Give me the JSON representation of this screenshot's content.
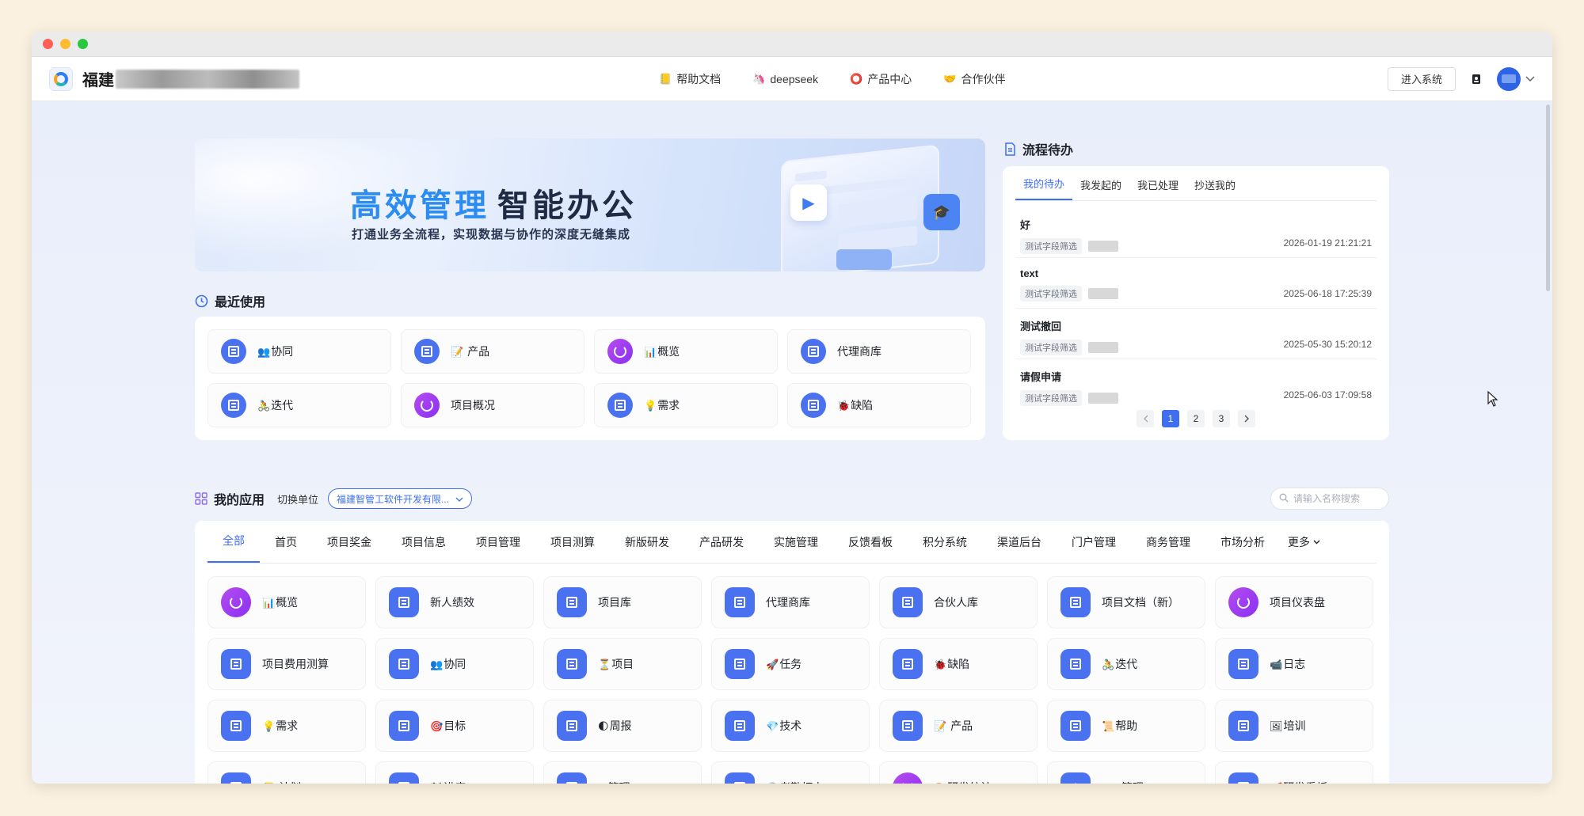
{
  "navbar": {
    "brand": "福建",
    "nav": [
      {
        "label": "帮助文档",
        "icon": "📒"
      },
      {
        "label": "deepseek",
        "icon": "🦄"
      },
      {
        "label": "产品中心",
        "icon": "⭕"
      },
      {
        "label": "合作伙伴",
        "icon": "🤝"
      }
    ],
    "enter": "进入系统"
  },
  "banner": {
    "title_blue": "高效管理",
    "title_dark": "智能办公",
    "subtitle": "打通业务全流程，实现数据与协作的深度无缝集成"
  },
  "recent": {
    "title": "最近使用",
    "items": [
      {
        "emoji": "👥",
        "label": "协同",
        "icon": "doc"
      },
      {
        "emoji": "📝",
        "label": " 产品",
        "icon": "doc"
      },
      {
        "emoji": "📊",
        "label": "概览",
        "icon": "pie"
      },
      {
        "emoji": "",
        "label": "代理商库",
        "icon": "doc"
      },
      {
        "emoji": "🚴",
        "label": "迭代",
        "icon": "doc"
      },
      {
        "emoji": "",
        "label": "项目概况",
        "icon": "pie"
      },
      {
        "emoji": "💡",
        "label": "需求",
        "icon": "doc"
      },
      {
        "emoji": "🐞",
        "label": "缺陷",
        "icon": "doc"
      }
    ]
  },
  "todo": {
    "title": "流程待办",
    "tabs": [
      "我的待办",
      "我发起的",
      "我已处理",
      "抄送我的"
    ],
    "items": [
      {
        "name": "好",
        "tag": "测试字段筛选",
        "time": "2026-01-19 21:21:21"
      },
      {
        "name": "text",
        "tag": "测试字段筛选",
        "time": "2025-06-18 17:25:39"
      },
      {
        "name": "测试撤回",
        "tag": "测试字段筛选",
        "time": "2025-05-30 15:20:12"
      },
      {
        "name": "请假申请",
        "tag": "测试字段筛选",
        "time": "2025-06-03 17:09:58"
      }
    ],
    "pages": [
      "1",
      "2",
      "3"
    ]
  },
  "apps": {
    "title": "我的应用",
    "switch_label": "切换单位",
    "unit": "福建智管工软件开发有限...",
    "search_placeholder": "请输入名称搜索",
    "categories": [
      "全部",
      "首页",
      "项目奖金",
      "项目信息",
      "项目管理",
      "项目测算",
      "新版研发",
      "产品研发",
      "实施管理",
      "反馈看板",
      "积分系统",
      "渠道后台",
      "门户管理",
      "商务管理",
      "市场分析"
    ],
    "more": "更多",
    "items": [
      {
        "emoji": "📊",
        "label": "概览",
        "icon": "pie"
      },
      {
        "emoji": "",
        "label": "新人绩效",
        "icon": "doc"
      },
      {
        "emoji": "",
        "label": "项目库",
        "icon": "doc"
      },
      {
        "emoji": "",
        "label": "代理商库",
        "icon": "doc"
      },
      {
        "emoji": "",
        "label": "合伙人库",
        "icon": "doc"
      },
      {
        "emoji": "",
        "label": "项目文档（新）",
        "icon": "doc"
      },
      {
        "emoji": "",
        "label": "项目仪表盘",
        "icon": "pie"
      },
      {
        "emoji": "",
        "label": "项目费用测算",
        "icon": "doc"
      },
      {
        "emoji": "👥",
        "label": "协同",
        "icon": "doc"
      },
      {
        "emoji": "⏳",
        "label": "项目",
        "icon": "doc"
      },
      {
        "emoji": "🚀",
        "label": "任务",
        "icon": "doc"
      },
      {
        "emoji": "🐞",
        "label": "缺陷",
        "icon": "doc"
      },
      {
        "emoji": "🚴",
        "label": "迭代",
        "icon": "doc"
      },
      {
        "emoji": "📹",
        "label": "日志",
        "icon": "doc"
      },
      {
        "emoji": "💡",
        "label": "需求",
        "icon": "doc"
      },
      {
        "emoji": "🎯",
        "label": "目标",
        "icon": "doc"
      },
      {
        "emoji": "🌓",
        "label": "周报",
        "icon": "doc"
      },
      {
        "emoji": "💎",
        "label": "技术",
        "icon": "doc"
      },
      {
        "emoji": "📝",
        "label": " 产品",
        "icon": "doc"
      },
      {
        "emoji": "📜",
        "label": "帮助",
        "icon": "doc"
      },
      {
        "emoji": "🖼",
        "label": "培训",
        "icon": "doc"
      },
      {
        "emoji": "📒",
        "label": " 计划",
        "icon": "doc"
      },
      {
        "emoji": "🏁",
        "label": "进度",
        "icon": "doc"
      },
      {
        "emoji": "⚙",
        "label": "管理",
        "icon": "doc"
      },
      {
        "emoji": "🕘",
        "label": "考勤打卡",
        "icon": "doc"
      },
      {
        "emoji": "🎨",
        "label": "研发统计",
        "icon": "pie"
      },
      {
        "emoji": "",
        "label": "Bug管理",
        "icon": "bug"
      },
      {
        "emoji": "🚀",
        "label": "研发看板",
        "icon": "doc"
      }
    ]
  }
}
